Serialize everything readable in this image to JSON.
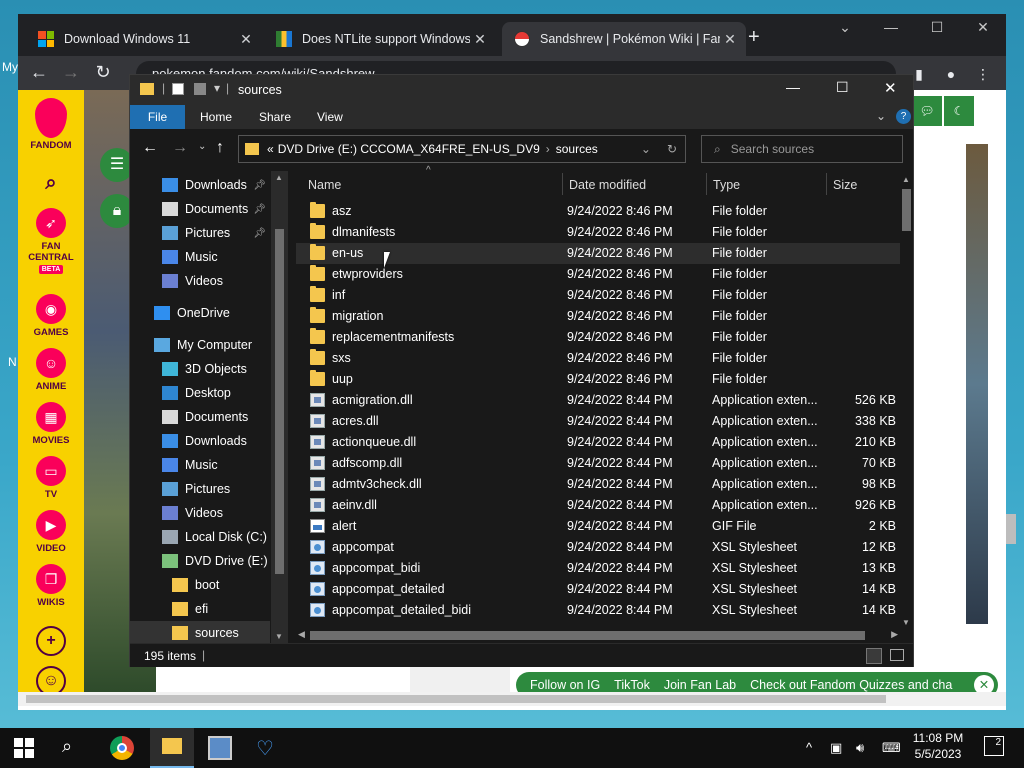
{
  "desktop": {
    "left_chars": [
      "My",
      "N"
    ]
  },
  "chrome": {
    "tabs": [
      {
        "title": "Download Windows 11",
        "close": "✕"
      },
      {
        "title": "Does NTLite support Windows 11",
        "close": "✕"
      },
      {
        "title": "Sandshrew | Pokémon Wiki | Fandom",
        "close": "✕"
      }
    ],
    "new_tab": "+",
    "url": "pokemon.fandom.com/wiki/Sandshrew"
  },
  "fandom_sidebar": {
    "brand": "FANDOM",
    "items": [
      {
        "label": "FAN",
        "label2": "CENTRAL",
        "badge": "BETA"
      },
      {
        "label": "GAMES"
      },
      {
        "label": "ANIME"
      },
      {
        "label": "MOVIES"
      },
      {
        "label": "TV"
      },
      {
        "label": "VIDEO"
      },
      {
        "label": "WIKIS"
      }
    ]
  },
  "fandom_footer": {
    "links": [
      "Follow on IG",
      "TikTok",
      "Join Fan Lab",
      "Check out Fandom Quizzes and cha"
    ],
    "close": "✕"
  },
  "explorer": {
    "title": "sources",
    "ribbon": {
      "file": "File",
      "home": "Home",
      "share": "Share",
      "view": "View"
    },
    "address": {
      "prefix": "«",
      "part1": "DVD Drive (E:) CCCOMA_X64FRE_EN-US_DV9",
      "sep": "›",
      "part2": "sources"
    },
    "search_placeholder": "Search sources",
    "nav": [
      {
        "label": "Downloads",
        "icon": "download-icon",
        "pinned": true,
        "indent": 1
      },
      {
        "label": "Documents",
        "icon": "document-icon",
        "pinned": true,
        "indent": 1
      },
      {
        "label": "Pictures",
        "icon": "pictures-icon",
        "pinned": true,
        "indent": 1
      },
      {
        "label": "Music",
        "icon": "music-icon",
        "pinned": false,
        "indent": 1
      },
      {
        "label": "Videos",
        "icon": "videos-icon",
        "pinned": false,
        "indent": 1
      },
      {
        "label": "OneDrive",
        "icon": "cloud-icon",
        "pinned": false,
        "indent": 0,
        "gap": true
      },
      {
        "label": "My Computer",
        "icon": "computer-icon",
        "pinned": false,
        "indent": 0,
        "gap": true
      },
      {
        "label": "3D Objects",
        "icon": "cube-icon",
        "pinned": false,
        "indent": 1
      },
      {
        "label": "Desktop",
        "icon": "desktop-icon",
        "pinned": false,
        "indent": 1
      },
      {
        "label": "Documents",
        "icon": "document-icon",
        "pinned": false,
        "indent": 1
      },
      {
        "label": "Downloads",
        "icon": "download-icon",
        "pinned": false,
        "indent": 1
      },
      {
        "label": "Music",
        "icon": "music-icon",
        "pinned": false,
        "indent": 1
      },
      {
        "label": "Pictures",
        "icon": "pictures-icon",
        "pinned": false,
        "indent": 1
      },
      {
        "label": "Videos",
        "icon": "videos-icon",
        "pinned": false,
        "indent": 1
      },
      {
        "label": "Local Disk (C:)",
        "icon": "disk-icon",
        "pinned": false,
        "indent": 1
      },
      {
        "label": "DVD Drive (E:) CCC",
        "icon": "dvd-icon",
        "pinned": false,
        "indent": 1
      },
      {
        "label": "boot",
        "icon": "folder-icon",
        "pinned": false,
        "indent": 2
      },
      {
        "label": "efi",
        "icon": "folder-icon",
        "pinned": false,
        "indent": 2
      },
      {
        "label": "sources",
        "icon": "folder-icon",
        "pinned": false,
        "indent": 2,
        "selected": true
      }
    ],
    "columns": {
      "name": "Name",
      "date": "Date modified",
      "type": "Type",
      "size": "Size"
    },
    "files": [
      {
        "name": "asz",
        "date": "9/24/2022 8:46 PM",
        "type": "File folder",
        "size": "",
        "kind": "folder"
      },
      {
        "name": "dlmanifests",
        "date": "9/24/2022 8:46 PM",
        "type": "File folder",
        "size": "",
        "kind": "folder"
      },
      {
        "name": "en-us",
        "date": "9/24/2022 8:46 PM",
        "type": "File folder",
        "size": "",
        "kind": "folder",
        "hover": true
      },
      {
        "name": "etwproviders",
        "date": "9/24/2022 8:46 PM",
        "type": "File folder",
        "size": "",
        "kind": "folder"
      },
      {
        "name": "inf",
        "date": "9/24/2022 8:46 PM",
        "type": "File folder",
        "size": "",
        "kind": "folder"
      },
      {
        "name": "migration",
        "date": "9/24/2022 8:46 PM",
        "type": "File folder",
        "size": "",
        "kind": "folder"
      },
      {
        "name": "replacementmanifests",
        "date": "9/24/2022 8:46 PM",
        "type": "File folder",
        "size": "",
        "kind": "folder"
      },
      {
        "name": "sxs",
        "date": "9/24/2022 8:46 PM",
        "type": "File folder",
        "size": "",
        "kind": "folder"
      },
      {
        "name": "uup",
        "date": "9/24/2022 8:46 PM",
        "type": "File folder",
        "size": "",
        "kind": "folder"
      },
      {
        "name": "acmigration.dll",
        "date": "9/24/2022 8:44 PM",
        "type": "Application exten...",
        "size": "526 KB",
        "kind": "dll"
      },
      {
        "name": "acres.dll",
        "date": "9/24/2022 8:44 PM",
        "type": "Application exten...",
        "size": "338 KB",
        "kind": "dll"
      },
      {
        "name": "actionqueue.dll",
        "date": "9/24/2022 8:44 PM",
        "type": "Application exten...",
        "size": "210 KB",
        "kind": "dll"
      },
      {
        "name": "adfscomp.dll",
        "date": "9/24/2022 8:44 PM",
        "type": "Application exten...",
        "size": "70 KB",
        "kind": "dll"
      },
      {
        "name": "admtv3check.dll",
        "date": "9/24/2022 8:44 PM",
        "type": "Application exten...",
        "size": "98 KB",
        "kind": "dll"
      },
      {
        "name": "aeinv.dll",
        "date": "9/24/2022 8:44 PM",
        "type": "Application exten...",
        "size": "926 KB",
        "kind": "dll"
      },
      {
        "name": "alert",
        "date": "9/24/2022 8:44 PM",
        "type": "GIF File",
        "size": "2 KB",
        "kind": "gif"
      },
      {
        "name": "appcompat",
        "date": "9/24/2022 8:44 PM",
        "type": "XSL Stylesheet",
        "size": "12 KB",
        "kind": "xsl"
      },
      {
        "name": "appcompat_bidi",
        "date": "9/24/2022 8:44 PM",
        "type": "XSL Stylesheet",
        "size": "13 KB",
        "kind": "xsl"
      },
      {
        "name": "appcompat_detailed",
        "date": "9/24/2022 8:44 PM",
        "type": "XSL Stylesheet",
        "size": "14 KB",
        "kind": "xsl"
      },
      {
        "name": "appcompat_detailed_bidi",
        "date": "9/24/2022 8:44 PM",
        "type": "XSL Stylesheet",
        "size": "14 KB",
        "kind": "xsl"
      }
    ],
    "status": "195 items"
  },
  "taskbar": {
    "time": "11:08 PM",
    "date": "5/5/2023",
    "notifications": "2"
  },
  "colors": {
    "explorer_bg": "#191919",
    "fandom_yellow": "#f8d100",
    "fandom_pink": "#fa005a",
    "accent_blue": "#1f6fb2",
    "folder": "#f4c64e"
  }
}
